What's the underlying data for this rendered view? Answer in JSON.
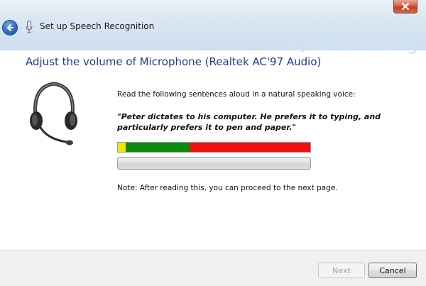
{
  "window": {
    "title": "Set up Speech Recognition",
    "watermark": "Quantrimang"
  },
  "icons": {
    "back": "back-arrow-icon",
    "microphone": "microphone-icon",
    "close": "close-icon",
    "headset": "headset-icon"
  },
  "page": {
    "heading": "Adjust the volume of Microphone (Realtek AC'97 Audio)",
    "instruction": "Read the following sentences aloud in a natural speaking voice:",
    "sentence": "\"Peter dictates to his computer. He prefers it to typing, and particularly prefers it to pen and paper.\"",
    "note": "Note: After reading this, you can proceed to the next page."
  },
  "level_meter": {
    "segments": [
      "yellow",
      "green",
      "red"
    ],
    "colors": {
      "yellow": "#f5e600",
      "green": "#0c8a0c",
      "red": "#f01010"
    }
  },
  "progress": {
    "value": 0
  },
  "footer": {
    "next_label": "Next",
    "next_enabled": false,
    "cancel_label": "Cancel"
  }
}
